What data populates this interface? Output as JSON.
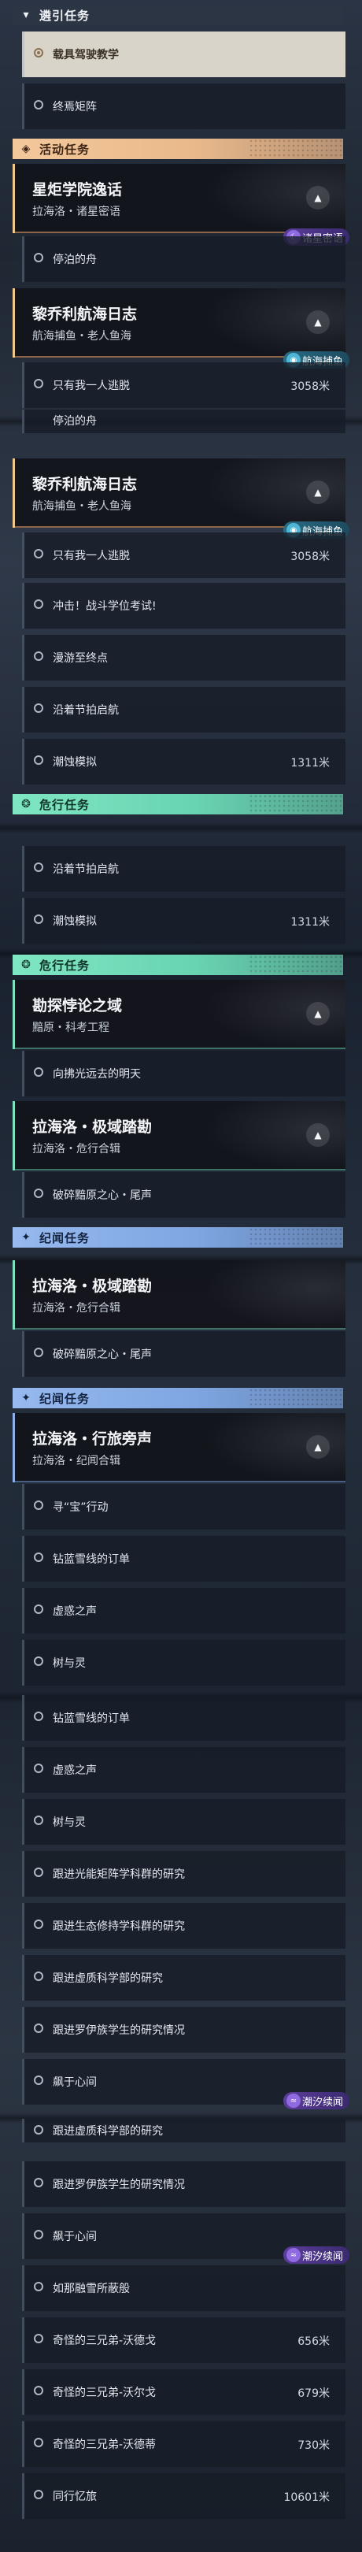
{
  "categories": {
    "guide": "遴引任务",
    "event": "活动任务",
    "danger": "危行任务",
    "epic": "纪闻任务"
  },
  "quests": {
    "starrail": {
      "title": "星炬学院逸话",
      "subtitle": "拉海洛・诸星密语"
    },
    "lichy": {
      "title": "黎乔利航海日志",
      "subtitle": "航海捕鱼・老人鱼海"
    },
    "explore": {
      "title": "勘探悖论之域",
      "subtitle": "黯原・科考工程"
    },
    "rahailo_danger": {
      "title": "拉海洛・极域踏勘",
      "subtitle": "拉海洛・危行合辑"
    },
    "rahailo_epic": {
      "title": "拉海洛・行旅旁声",
      "subtitle": "拉海洛・纪闻合辑"
    }
  },
  "badges": {
    "zhuxing": "诸星密语",
    "hanghai": "航海捕鱼",
    "chaoxi": "潮汐续闻"
  },
  "tasks": {
    "t_zaiju": "载具驾驶教学",
    "t_zhongyan": "终焉矩阵",
    "t_tingbo": "停泊的舟",
    "t_yiren": "只有我一人逃脱",
    "t_chongji": "冲击！战斗学位考试!",
    "t_manyou": "漫游至终点",
    "t_yanzhe": "沿着节拍启航",
    "t_chaoshi": "潮蚀模拟",
    "t_xiangzhe": "向拂光远去的明天",
    "t_posui": "破碎黯原之心・尾声",
    "t_xunbao": "寻“宝”行动",
    "t_zuanlan": "钻蓝雪线的订单",
    "t_xuwu": "虚惑之声",
    "t_shuyuling": "树与灵",
    "t_guangneng": "跟进光能矩阵学科群的研究",
    "t_shengtai": "跟进生态修持学科群的研究",
    "t_xuzhi": "跟进虚质科学部的研究",
    "t_luoyi": "跟进罗伊族学生的研究情况",
    "t_bianyu": "飙于心间",
    "t_rumei": "如那融雪所蔽般",
    "t_qiguai_wode": "奇怪的三兄弟-沃德戈",
    "t_qiguai_woer": "奇怪的三兄弟-沃尔戈",
    "t_qiguai_wodelai": "奇怪的三兄弟-沃德蒂",
    "t_tongxing": "同行忆旅",
    "t_tingbo_cut": "停泊的舟"
  },
  "distances": {
    "d3058": "3058米",
    "d1311": "1311米",
    "d656": "656米",
    "d679": "679米",
    "d730": "730米",
    "d10601": "10601米"
  },
  "icons": {
    "guide": "chevron-icon",
    "event": "event-icon",
    "danger": "danger-icon",
    "epic": "star-icon",
    "collapse": "chevron-up-icon",
    "radio": "radio-icon"
  }
}
